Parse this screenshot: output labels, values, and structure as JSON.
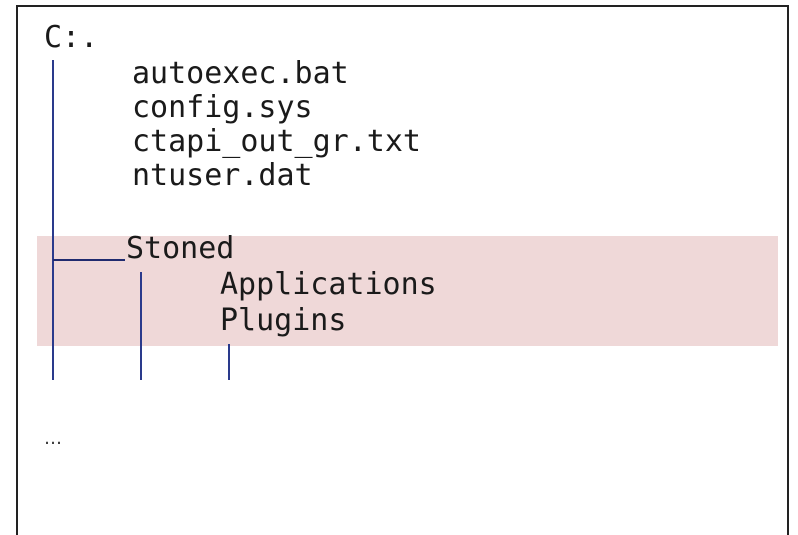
{
  "tree": {
    "root": "C:.",
    "root_files": [
      "autoexec.bat",
      "config.sys",
      "ctapi_out_gr.txt",
      "ntuser.dat"
    ],
    "folder": {
      "name": "Stoned",
      "children": [
        "Applications",
        "Plugins"
      ]
    },
    "more": "…"
  },
  "colors": {
    "highlight": "#efd8d8",
    "tree_lines": "#2a3a8c",
    "border": "#222222"
  }
}
